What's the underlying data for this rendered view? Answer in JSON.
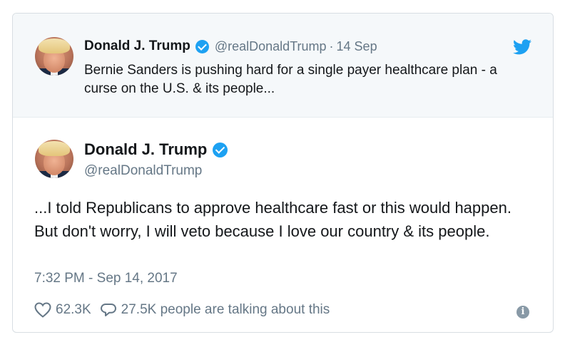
{
  "parent_tweet": {
    "author_name": "Donald J. Trump",
    "handle": "@realDonaldTrump",
    "separator": "·",
    "date": "14 Sep",
    "text": "Bernie Sanders is pushing hard for a single payer healthcare plan - a curse on the U.S. & its people...",
    "icons": [
      "verified-badge-icon",
      "twitter-bird-icon"
    ]
  },
  "tweet": {
    "author_name": "Donald J. Trump",
    "handle": "@realDonaldTrump",
    "text": "...I told Republicans to approve healthcare fast or this would happen. But don't worry, I will veto because I love our country & its people.",
    "timestamp": "7:32 PM - Sep 14, 2017",
    "like_count": "62.3K",
    "reply_text": "27.5K people are talking about this",
    "icons": [
      "heart-icon",
      "reply-bubble-icon",
      "info-icon"
    ]
  },
  "colors": {
    "brand_blue": "#1da1f2",
    "secondary_text": "#657786",
    "primary_text": "#14171a",
    "parent_background": "#f5f8fa",
    "border": "#d8dee3"
  }
}
